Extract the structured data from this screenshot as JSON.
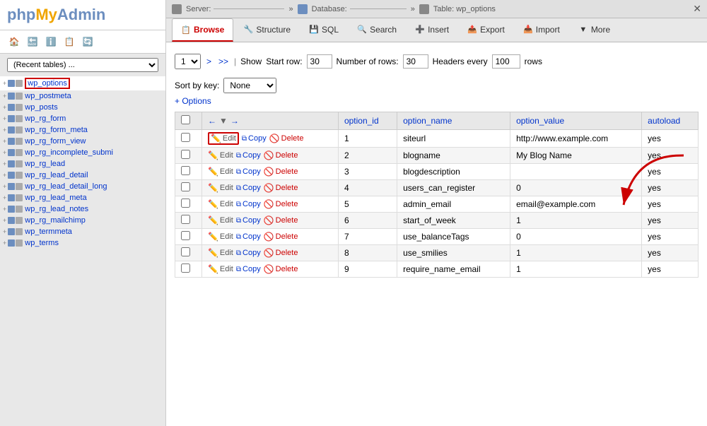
{
  "sidebar": {
    "logo": {
      "php": "php",
      "my": "My",
      "admin": "Admin"
    },
    "icons": [
      "home",
      "back",
      "info",
      "copy",
      "refresh"
    ],
    "recent_label": "(Recent tables) ...",
    "tables": [
      {
        "name": "wp_options",
        "active": true
      },
      {
        "name": "wp_postmeta",
        "active": false
      },
      {
        "name": "wp_posts",
        "active": false
      },
      {
        "name": "wp_rg_form",
        "active": false
      },
      {
        "name": "wp_rg_form_meta",
        "active": false
      },
      {
        "name": "wp_rg_form_view",
        "active": false
      },
      {
        "name": "wp_rg_incomplete_submi",
        "active": false
      },
      {
        "name": "wp_rg_lead",
        "active": false
      },
      {
        "name": "wp_rg_lead_detail",
        "active": false
      },
      {
        "name": "wp_rg_lead_detail_long",
        "active": false
      },
      {
        "name": "wp_rg_lead_meta",
        "active": false
      },
      {
        "name": "wp_rg_lead_notes",
        "active": false
      },
      {
        "name": "wp_rg_mailchimp",
        "active": false
      },
      {
        "name": "wp_termmeta",
        "active": false
      },
      {
        "name": "wp_terms",
        "active": false
      }
    ]
  },
  "topbar": {
    "server_label": "Server:",
    "server_value": "",
    "db_label": "Database:",
    "db_value": "",
    "table_label": "Table: wp_options"
  },
  "nav": {
    "tabs": [
      {
        "id": "browse",
        "label": "Browse",
        "icon": "📋",
        "active": true
      },
      {
        "id": "structure",
        "label": "Structure",
        "icon": "🔧",
        "active": false
      },
      {
        "id": "sql",
        "label": "SQL",
        "icon": "💾",
        "active": false
      },
      {
        "id": "search",
        "label": "Search",
        "icon": "🔍",
        "active": false
      },
      {
        "id": "insert",
        "label": "Insert",
        "icon": "➕",
        "active": false
      },
      {
        "id": "export",
        "label": "Export",
        "icon": "📤",
        "active": false
      },
      {
        "id": "import",
        "label": "Import",
        "icon": "📥",
        "active": false
      },
      {
        "id": "more",
        "label": "More",
        "icon": "▼",
        "active": false
      }
    ]
  },
  "pagination": {
    "page_select": "1",
    "nav_next": ">",
    "nav_last": ">>",
    "show_label": "Show",
    "start_row_label": "Start row:",
    "start_row_value": "30",
    "num_rows_label": "Number of rows:",
    "num_rows_value": "30",
    "headers_label": "Headers every",
    "headers_value": "100",
    "rows_label": "rows"
  },
  "sort": {
    "label": "Sort by key:",
    "value": "None"
  },
  "options_link": "+ Options",
  "table": {
    "col_headers": [
      "",
      "",
      "option_id",
      "option_name",
      "option_value",
      "autoload"
    ],
    "rows": [
      {
        "id": 1,
        "option_name": "siteurl",
        "option_value": "http://www.example.com",
        "autoload": "yes",
        "highlight_edit": true
      },
      {
        "id": 2,
        "option_name": "blogname",
        "option_value": "My Blog Name",
        "autoload": "yes",
        "highlight_edit": false
      },
      {
        "id": 3,
        "option_name": "blogdescription",
        "option_value": "",
        "autoload": "yes",
        "highlight_edit": false
      },
      {
        "id": 4,
        "option_name": "users_can_register",
        "option_value": "0",
        "autoload": "yes",
        "highlight_edit": false
      },
      {
        "id": 5,
        "option_name": "admin_email",
        "option_value": "email@example.com",
        "autoload": "yes",
        "highlight_edit": false
      },
      {
        "id": 6,
        "option_name": "start_of_week",
        "option_value": "1",
        "autoload": "yes",
        "highlight_edit": false
      },
      {
        "id": 7,
        "option_name": "use_balanceTags",
        "option_value": "0",
        "autoload": "yes",
        "highlight_edit": false
      },
      {
        "id": 8,
        "option_name": "use_smilies",
        "option_value": "1",
        "autoload": "yes",
        "highlight_edit": false
      },
      {
        "id": 9,
        "option_name": "require_name_email",
        "option_value": "1",
        "autoload": "yes",
        "highlight_edit": false
      }
    ],
    "action_edit": "Edit",
    "action_copy": "Copy",
    "action_delete": "Delete"
  }
}
